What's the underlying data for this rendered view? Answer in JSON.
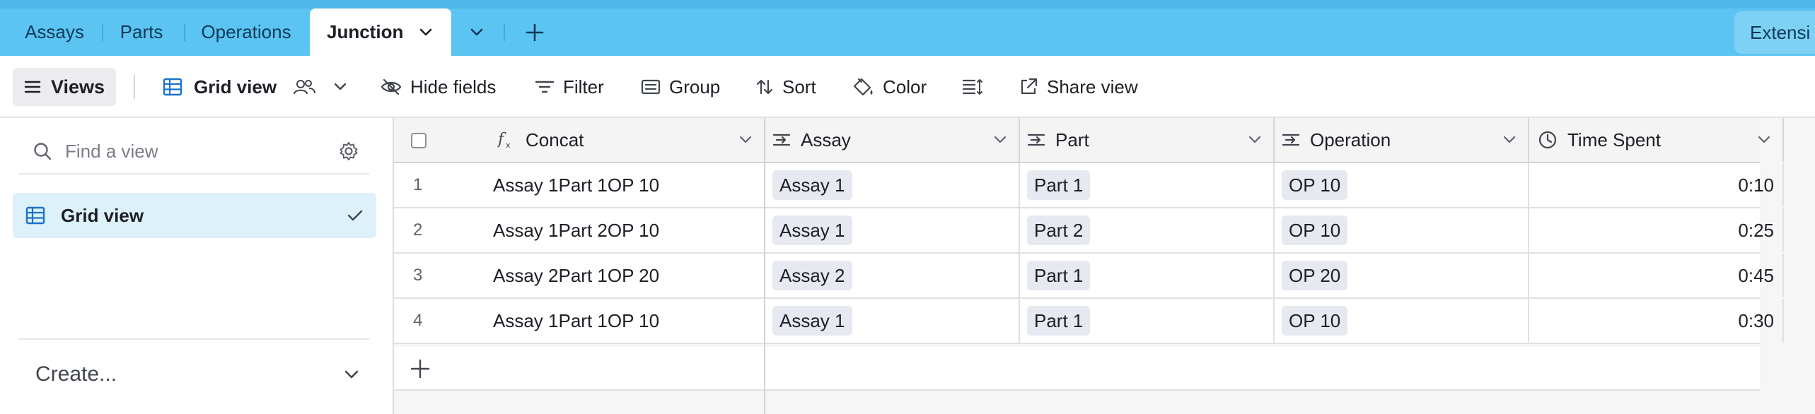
{
  "tabs": {
    "items": [
      {
        "label": "Assays"
      },
      {
        "label": "Parts"
      },
      {
        "label": "Operations"
      },
      {
        "label": "Junction",
        "active": true
      }
    ],
    "extensions_label": "Extensi"
  },
  "toolbar": {
    "views_label": "Views",
    "view_name": "Grid view",
    "hide_fields": "Hide fields",
    "filter": "Filter",
    "group": "Group",
    "sort": "Sort",
    "color": "Color",
    "share_view": "Share view"
  },
  "sidebar": {
    "search_placeholder": "Find a view",
    "views": [
      {
        "label": "Grid view",
        "selected": true
      }
    ],
    "create_label": "Create..."
  },
  "grid": {
    "columns": [
      "Concat",
      "Assay",
      "Part",
      "Operation",
      "Time Spent"
    ],
    "rows": [
      {
        "num": "1",
        "concat": "Assay 1Part 1OP 10",
        "assay": "Assay 1",
        "part": "Part 1",
        "operation": "OP 10",
        "time": "0:10"
      },
      {
        "num": "2",
        "concat": "Assay 1Part 2OP 10",
        "assay": "Assay 1",
        "part": "Part 2",
        "operation": "OP 10",
        "time": "0:25"
      },
      {
        "num": "3",
        "concat": "Assay 2Part 1OP 20",
        "assay": "Assay 2",
        "part": "Part 1",
        "operation": "OP 20",
        "time": "0:45"
      },
      {
        "num": "4",
        "concat": "Assay 1Part 1OP 10",
        "assay": "Assay 1",
        "part": "Part 1",
        "operation": "OP 10",
        "time": "0:30"
      }
    ]
  },
  "colors": {
    "tabbar": "#5bc4f2",
    "selected_view": "#ddf1fa",
    "chip": "#e6e9f0"
  }
}
